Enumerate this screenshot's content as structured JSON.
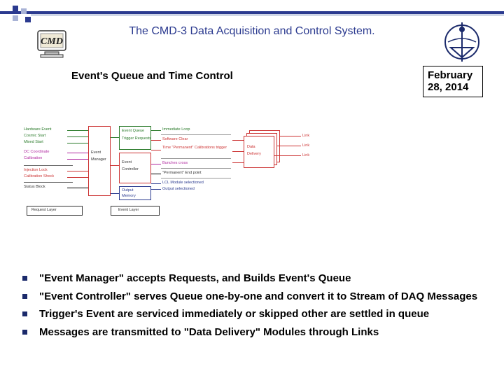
{
  "title": "The CMD-3 Data Acquisition and Control System.",
  "subtitle": "Event's Queue and Time Control",
  "date_line1": "February",
  "date_line2": "28, 2014",
  "diagram": {
    "req_labels": [
      "Hardware Event",
      "Cosmic Start",
      "Mixed Start",
      "DC Coordinate",
      "Calibration",
      "Injection Lock",
      "Calibration Shock",
      "Status Block"
    ],
    "bottom_left_label": "Request Layer",
    "bottom_center_label": "Event Layer",
    "box_event_manager_l1": "Event",
    "box_event_manager_l2": "Manager",
    "box_event_controller_l1": "Event",
    "box_event_controller_l2": "Controller",
    "box_queue_top": "Event Queue",
    "box_queue_sub": "Trigger Requests",
    "box_output_l1": "Output",
    "box_output_l2": "Memory",
    "col2_items": [
      "Immediate Loop",
      "Software Clear",
      "Time \"Permanent\" Calibrations trigger",
      "Bunches cross",
      "\"Permanent\" End point",
      "LCL Module selectioned",
      "Output selectioned"
    ],
    "box_data_l1": "Data",
    "box_data_l2": "Delivery",
    "link_label": "Link"
  },
  "bullets": [
    "\"Event Manager\" accepts Requests, and Builds Event's Queue",
    " \"Event Controller\" serves Queue one-by-one and convert it to Stream of DAQ Messages",
    "Trigger's Event are serviced immediately or skipped other are settled in queue",
    "Messages are transmitted to \"Data Delivery\" Modules through Links"
  ]
}
